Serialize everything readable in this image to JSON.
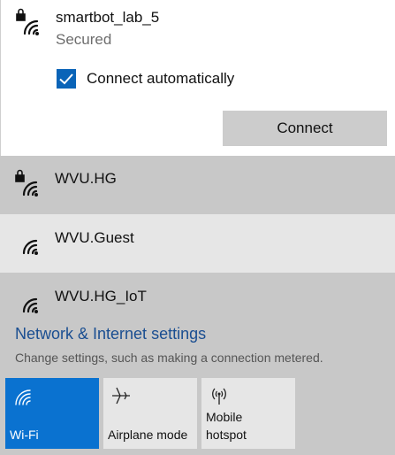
{
  "expanded_network": {
    "name": "smartbot_lab_5",
    "status": "Secured",
    "auto_connect_label": "Connect automatically",
    "auto_connect_checked": true,
    "connect_label": "Connect",
    "icon": "wifi-secured-icon"
  },
  "networks": [
    {
      "name": "WVU.HG",
      "secured": true,
      "icon": "wifi-secured-icon"
    },
    {
      "name": "WVU.Guest",
      "secured": false,
      "icon": "wifi-icon"
    },
    {
      "name": "WVU.HG_IoT",
      "secured": false,
      "icon": "wifi-icon"
    }
  ],
  "settings": {
    "link": "Network & Internet settings",
    "description": "Change settings, such as making a connection metered."
  },
  "quick_actions": [
    {
      "label": "Wi-Fi",
      "icon": "wifi-icon",
      "active": true
    },
    {
      "label": "Airplane mode",
      "icon": "airplane-icon",
      "active": false
    },
    {
      "label": "Mobile\nhotspot",
      "icon": "hotspot-icon",
      "active": false
    }
  ],
  "colors": {
    "accent": "#0a72d0",
    "link": "#1a4e91",
    "tile_bg": "#e6e6e6",
    "panel_bg": "#c8c8c8"
  }
}
